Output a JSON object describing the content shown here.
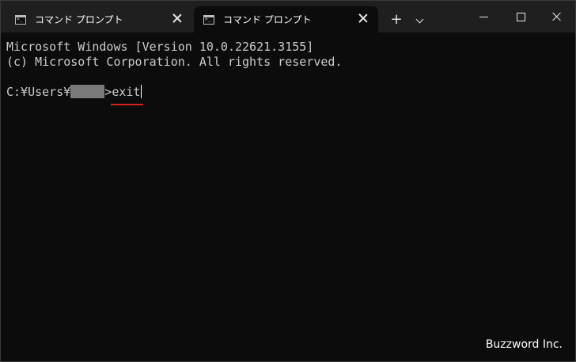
{
  "window": {
    "tabs": [
      {
        "label": "コマンド プロンプト",
        "active": false,
        "icon": "cmd-icon"
      },
      {
        "label": "コマンド プロンプト",
        "active": true,
        "icon": "cmd-icon"
      }
    ],
    "new_tab_label": "+"
  },
  "terminal": {
    "line1": "Microsoft Windows [Version 10.0.22621.3155]",
    "line2": "(c) Microsoft Corporation. All rights reserved.",
    "prompt_prefix": "C:¥Users¥",
    "prompt_suffix": ">",
    "command": "exit"
  },
  "watermark": "Buzzword Inc.",
  "colors": {
    "background": "#0c0c0c",
    "titlebar": "#1f1f1f",
    "text": "#cccccc",
    "underline": "#d42020"
  }
}
